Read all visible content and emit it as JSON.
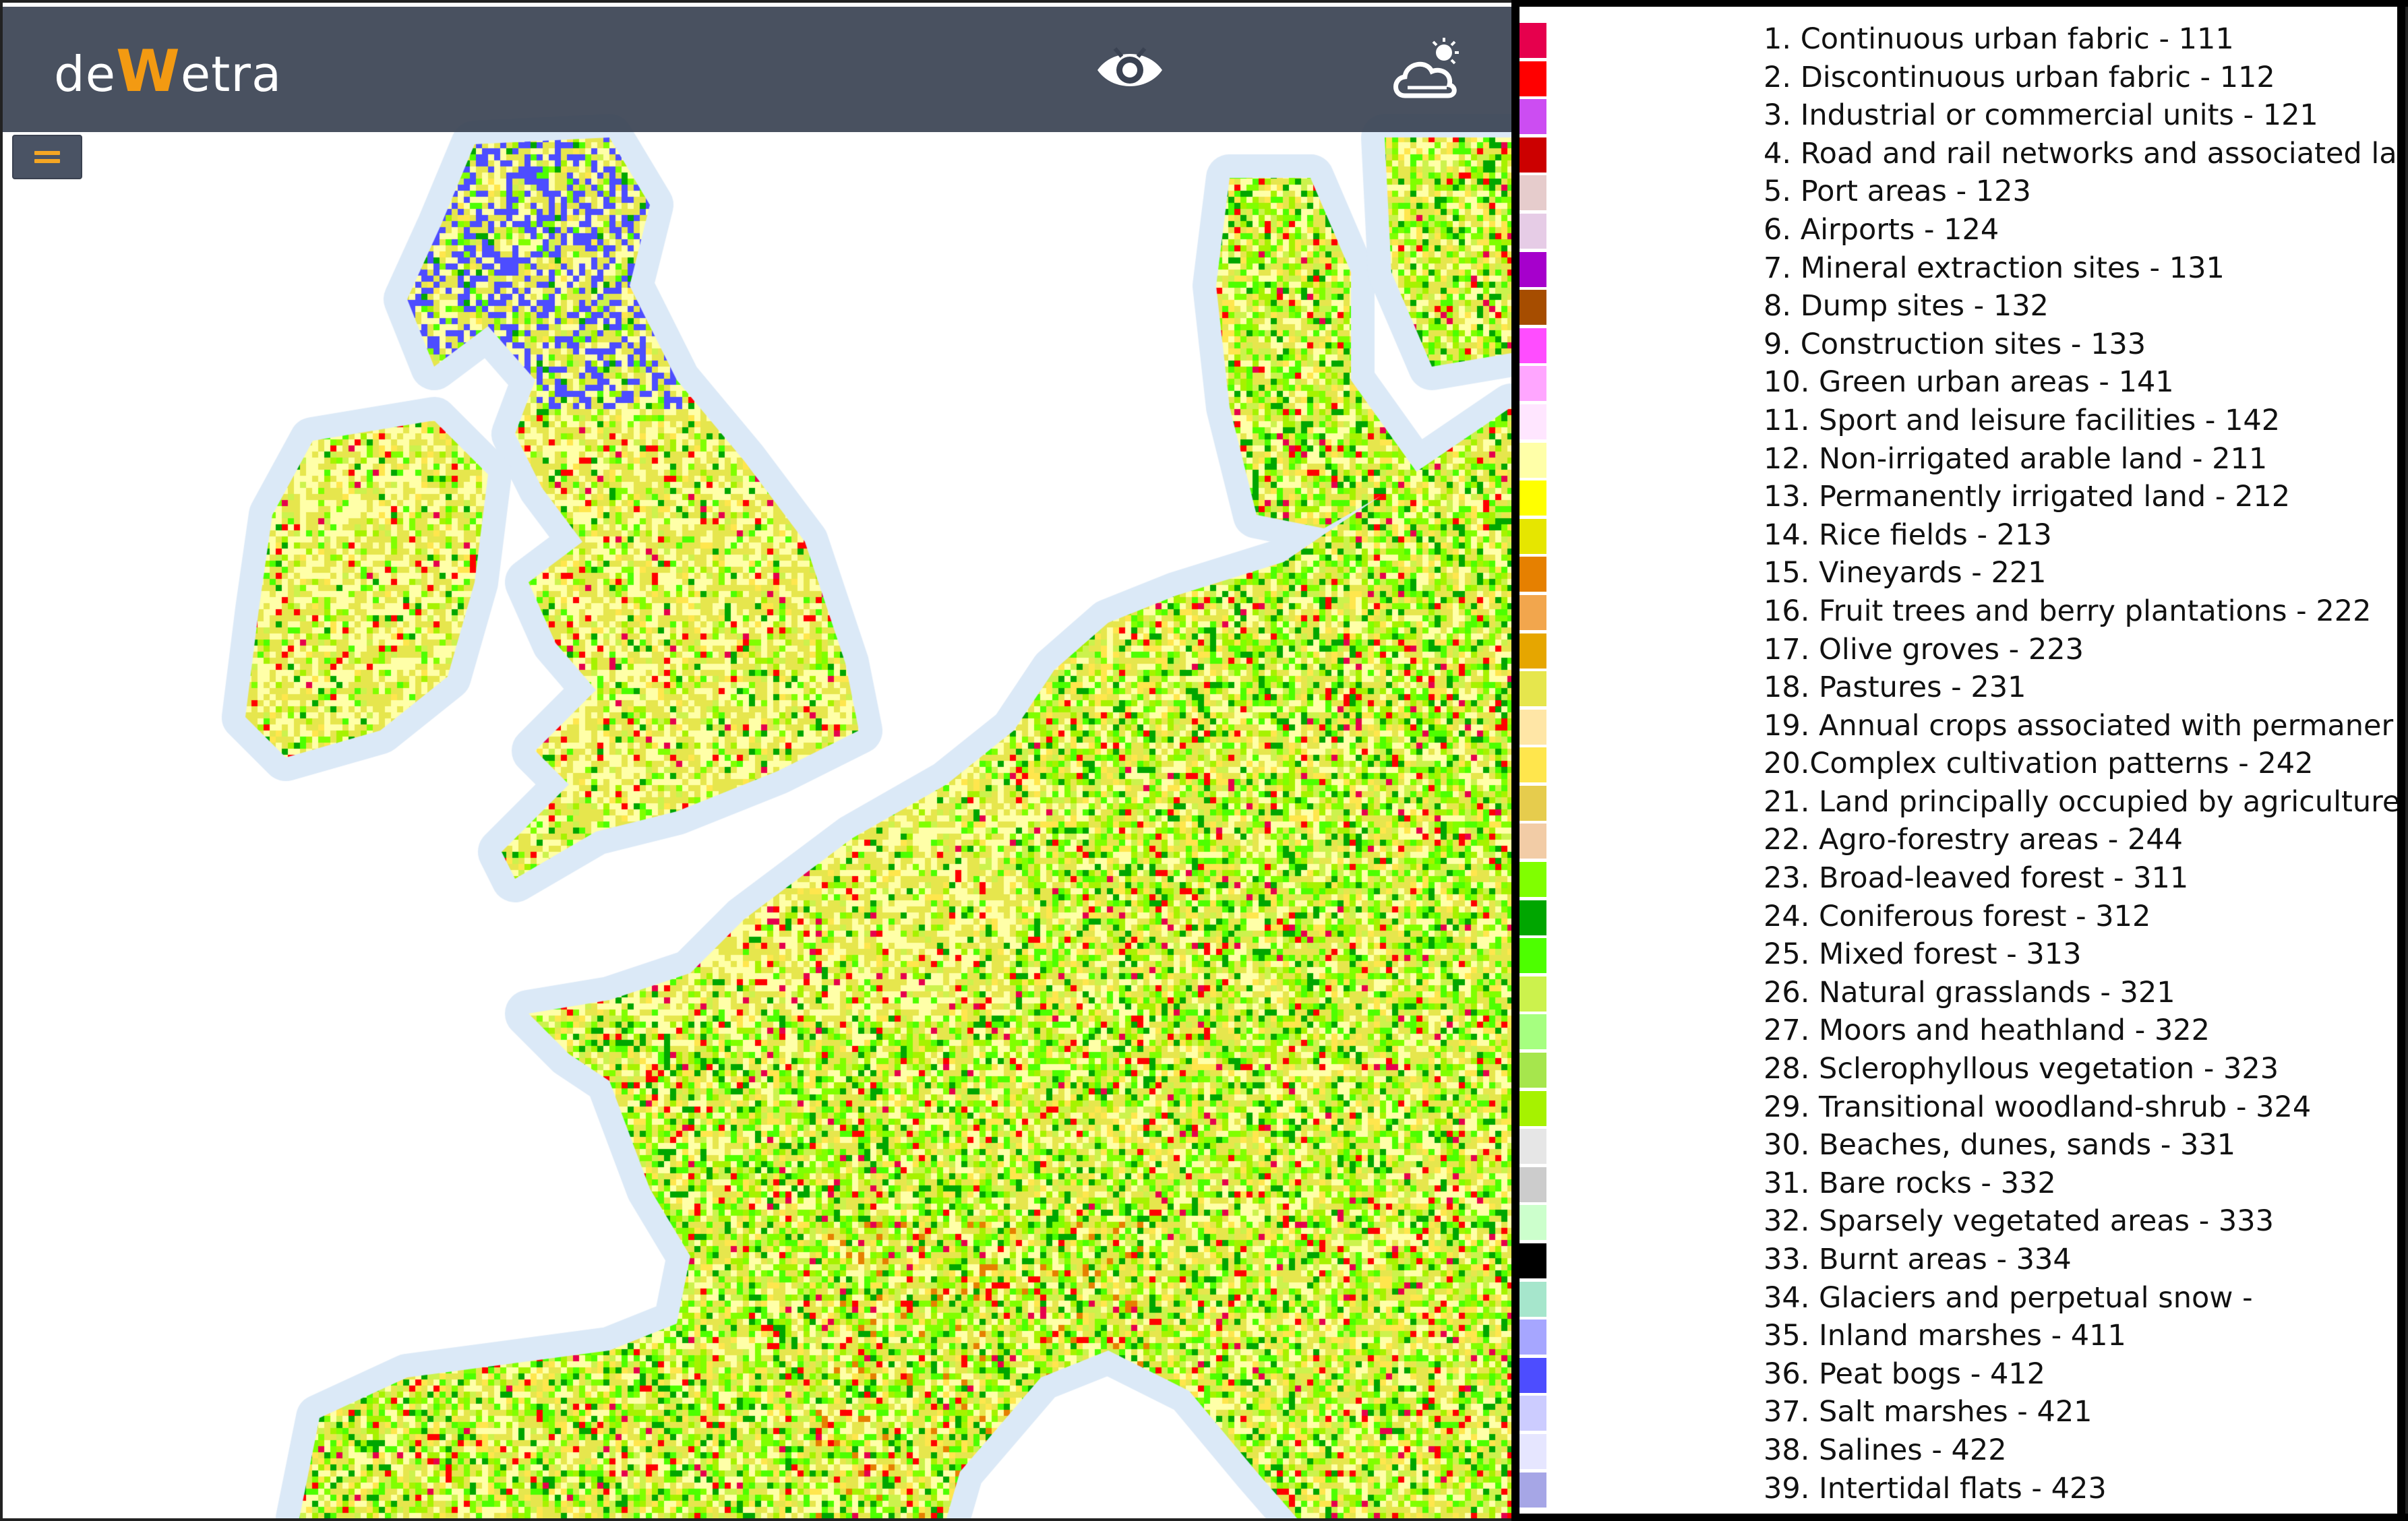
{
  "app": {
    "logo_text_left": "de",
    "logo_text_w": "W",
    "logo_text_right": "etra",
    "eye_icon": "eye-icon",
    "weather_icon": "cloud-sun-icon",
    "menu_icon": "hamburger-icon"
  },
  "colors": {
    "top_bar": "#3a4252",
    "logo_accent": "#f39a12",
    "menu_accent": "#f5a623",
    "sea": "#ffffff",
    "coast_halo": "#dbe9f7"
  },
  "legend": {
    "items": [
      {
        "label": "1. Continuous urban fabric - 111",
        "color": "#e6004d"
      },
      {
        "label": "2. Discontinuous urban fabric - 112",
        "color": "#ff0000"
      },
      {
        "label": "3. Industrial or commercial units - 121",
        "color": "#cc4df2"
      },
      {
        "label": "4. Road and rail networks and associated la",
        "color": "#cc0000"
      },
      {
        "label": "5. Port areas - 123",
        "color": "#e6cccc"
      },
      {
        "label": "6. Airports - 124",
        "color": "#e6cce6"
      },
      {
        "label": "7. Mineral extraction sites - 131",
        "color": "#a600cc"
      },
      {
        "label": "8. Dump sites - 132",
        "color": "#a64d00"
      },
      {
        "label": "9. Construction sites - 133",
        "color": "#ff4dff"
      },
      {
        "label": "10. Green urban areas - 141",
        "color": "#ffa6ff"
      },
      {
        "label": "11. Sport and leisure facilities - 142",
        "color": "#ffe6ff"
      },
      {
        "label": "12. Non-irrigated arable land - 211",
        "color": "#ffffa8"
      },
      {
        "label": "13. Permanently irrigated land - 212",
        "color": "#ffff00"
      },
      {
        "label": "14. Rice fields - 213",
        "color": "#e6e600"
      },
      {
        "label": "15. Vineyards - 221",
        "color": "#e68000"
      },
      {
        "label": "16. Fruit trees and berry plantations - 222",
        "color": "#f2a64d"
      },
      {
        "label": "17. Olive groves - 223",
        "color": "#e6a600"
      },
      {
        "label": "18. Pastures - 231",
        "color": "#e6e64d"
      },
      {
        "label": "19. Annual crops associated with permaner",
        "color": "#ffe6a6"
      },
      {
        "label": "20.Complex cultivation patterns - 242",
        "color": "#ffe64d"
      },
      {
        "label": "21. Land principally occupied by agriculture",
        "color": "#e6cc4d"
      },
      {
        "label": "22. Agro-forestry areas - 244",
        "color": "#f2cca6"
      },
      {
        "label": "23. Broad-leaved forest - 311",
        "color": "#80ff00"
      },
      {
        "label": "24. Coniferous forest - 312",
        "color": "#00a600"
      },
      {
        "label": "25. Mixed forest - 313",
        "color": "#4dff00"
      },
      {
        "label": "26. Natural grasslands - 321",
        "color": "#ccf24d"
      },
      {
        "label": "27. Moors and heathland - 322",
        "color": "#a6ff80"
      },
      {
        "label": "28. Sclerophyllous vegetation - 323",
        "color": "#a6e64d"
      },
      {
        "label": "29. Transitional woodland-shrub - 324",
        "color": "#a6f200"
      },
      {
        "label": "30. Beaches, dunes, sands - 331",
        "color": "#e6e6e6"
      },
      {
        "label": "31. Bare rocks - 332",
        "color": "#cccccc"
      },
      {
        "label": "32. Sparsely vegetated areas - 333",
        "color": "#ccffcc"
      },
      {
        "label": "33. Burnt areas - 334",
        "color": "#000000"
      },
      {
        "label": "34. Glaciers and perpetual snow -",
        "color": "#a6e6cc"
      },
      {
        "label": "35. Inland marshes - 411",
        "color": "#a6a6ff"
      },
      {
        "label": "36. Peat bogs - 412",
        "color": "#4d4dff"
      },
      {
        "label": "37. Salt marshes - 421",
        "color": "#ccccff"
      },
      {
        "label": "38. Salines - 422",
        "color": "#e6e6ff"
      },
      {
        "label": "39. Intertidal flats - 423",
        "color": "#a6a6e6"
      }
    ]
  }
}
